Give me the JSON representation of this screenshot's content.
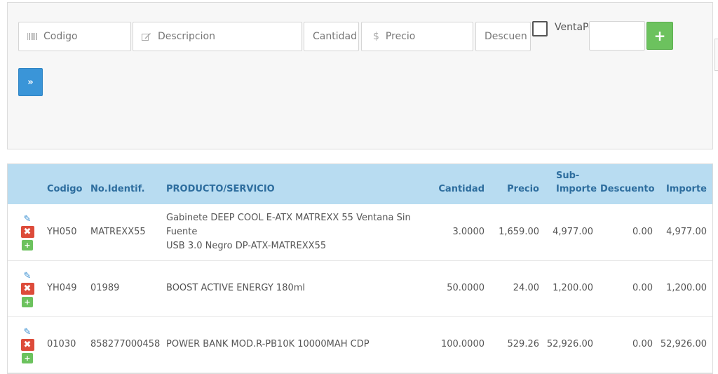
{
  "form": {
    "codigo_placeholder": "Codigo",
    "descripcion_placeholder": "Descripcion",
    "cantidad_placeholder": "Cantidad",
    "precio_placeholder": "Precio",
    "descuento_placeholder": "Descuen",
    "venta_label": "VentaPo",
    "add_button": "+",
    "next_button": "»"
  },
  "table": {
    "headers": {
      "codigo": "Codigo",
      "identif": "No.Identif.",
      "producto": "PRODUCTO/SERVICIO",
      "cantidad": "Cantidad",
      "precio": "Precio",
      "subimporte_1": "Sub-",
      "subimporte_2": "Importe",
      "descuento": "Descuento",
      "importe": "Importe"
    },
    "rows": [
      {
        "codigo": "YH050",
        "identif": "MATREXX55",
        "producto_1": "Gabinete DEEP COOL E-ATX MATREXX 55 Ventana Sin Fuente",
        "producto_2": "USB 3.0 Negro DP-ATX-MATREXX55",
        "cantidad": "3.0000",
        "precio": "1,659.00",
        "subimporte": "4,977.00",
        "descuento": "0.00",
        "importe": "4,977.00"
      },
      {
        "codigo": "YH049",
        "identif": "01989",
        "producto_1": "BOOST ACTIVE ENERGY 180ml",
        "producto_2": "",
        "cantidad": "50.0000",
        "precio": "24.00",
        "subimporte": "1,200.00",
        "descuento": "0.00",
        "importe": "1,200.00"
      },
      {
        "codigo": "01030",
        "identif": "858277000458",
        "producto_1": "POWER BANK MOD.R-PB10K 10000MAH CDP",
        "producto_2": "",
        "cantidad": "100.0000",
        "precio": "529.26",
        "subimporte": "52,926.00",
        "descuento": "0.00",
        "importe": "52,926.00"
      }
    ],
    "row_actions": {
      "edit": "✎",
      "delete": "✖",
      "add": "+"
    }
  },
  "icons": {
    "codigo": "barcode-icon",
    "descripcion": "pencil-square-icon",
    "precio": "dollar-icon"
  },
  "colors": {
    "add_button": "#6cc25e",
    "next_button": "#3a95d8",
    "delete_action": "#dd4b3a",
    "header_bg": "#b8dcf1",
    "header_text": "#2d6d9e"
  }
}
